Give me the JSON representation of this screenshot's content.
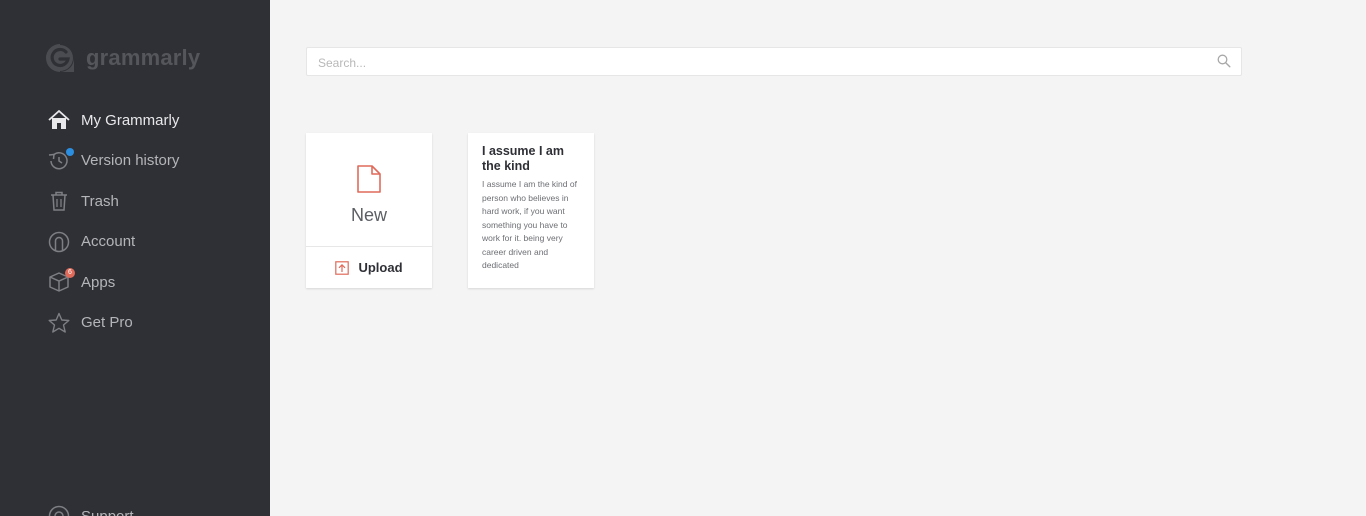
{
  "app": {
    "logo_text": "grammarly"
  },
  "sidebar": {
    "items": [
      {
        "label": "My Grammarly",
        "icon": "home-icon",
        "active": true
      },
      {
        "label": "Version history",
        "icon": "history-icon"
      },
      {
        "label": "Trash",
        "icon": "trash-icon"
      },
      {
        "label": "Account",
        "icon": "account-icon"
      },
      {
        "label": "Apps",
        "icon": "apps-icon",
        "badge": "6"
      },
      {
        "label": "Get Pro",
        "icon": "star-icon"
      }
    ],
    "footer": {
      "label": "Support",
      "icon": "support-icon"
    }
  },
  "search": {
    "placeholder": "Search..."
  },
  "new_card": {
    "new_label": "New",
    "upload_label": "Upload"
  },
  "documents": [
    {
      "title": "I assume I am the kind",
      "preview": "I assume I am the kind of person who believes in hard work, if you want something you have to work for it. being very career driven and dedicated"
    }
  ],
  "colors": {
    "sidebar_bg": "#2f3036",
    "page_bg": "#f4f4f4",
    "accent": "#e06a5a",
    "notification_dot": "#2b8ee0"
  }
}
